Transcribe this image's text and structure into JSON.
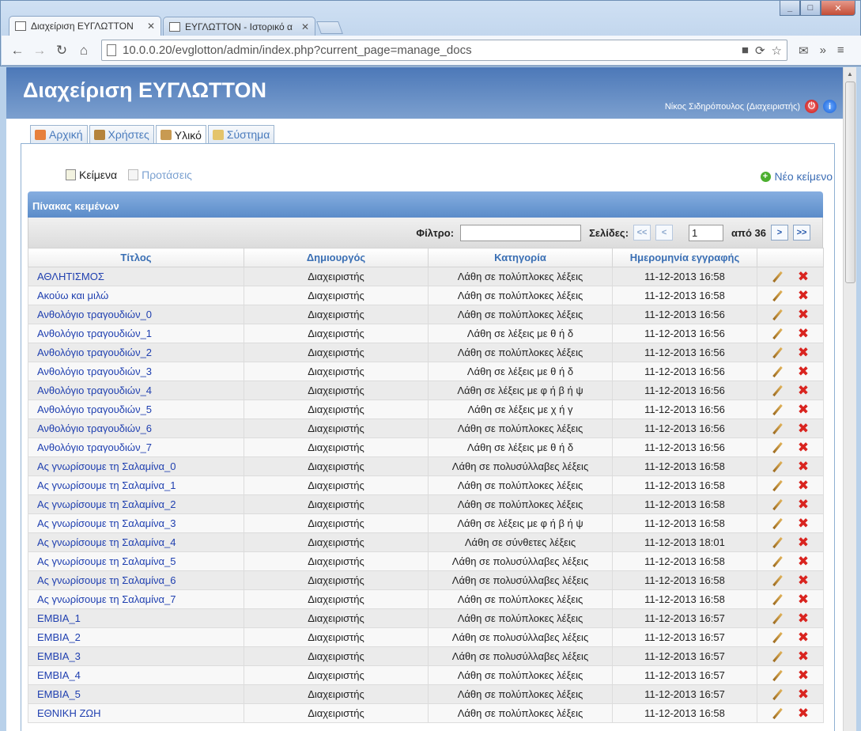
{
  "browser": {
    "tabs": [
      {
        "title": "Διαχείριση ΕΥΓΛΩΤΤΟΝ",
        "active": true
      },
      {
        "title": "ΕΥΓΛΩΤΤΟΝ - Ιστορικό α",
        "active": false
      }
    ],
    "url": "10.0.0.20/evglotton/admin/index.php?current_page=manage_docs"
  },
  "header": {
    "title": "Διαχείριση ΕΥΓΛΩΤΤΟΝ",
    "user": "Νίκος Σιδηρόπουλος (Διαχειριστής)"
  },
  "menu": [
    {
      "label": "Αρχική",
      "icon": "home-icon",
      "active": false
    },
    {
      "label": "Χρήστες",
      "icon": "users-icon",
      "active": false
    },
    {
      "label": "Υλικό",
      "icon": "books-icon",
      "active": true
    },
    {
      "label": "Σύστημα",
      "icon": "tools-icon",
      "active": false
    }
  ],
  "subnav": {
    "texts": "Κείμενα",
    "sentences": "Προτάσεις",
    "new_doc": "Νέο κείμενο"
  },
  "panel": {
    "title": "Πίνακας κειμένων",
    "filter_label": "Φίλτρο:",
    "pages_label": "Σελίδες:",
    "first_btn": "<<",
    "prev_btn": "<",
    "next_btn": ">",
    "last_btn": ">>",
    "current_page": "1",
    "of_label": "από 36"
  },
  "table": {
    "headers": [
      "Τίτλος",
      "Δημιουργός",
      "Κατηγορία",
      "Ημερομηνία εγγραφής",
      ""
    ],
    "rows": [
      [
        "ΑΘΛΗΤΙΣΜΟΣ",
        "Διαχειριστής",
        "Λάθη σε πολύπλοκες λέξεις",
        "11-12-2013 16:58"
      ],
      [
        "Ακούω και μιλώ",
        "Διαχειριστής",
        "Λάθη σε πολύπλοκες λέξεις",
        "11-12-2013 16:58"
      ],
      [
        "Ανθολόγιο τραγουδιών_0",
        "Διαχειριστής",
        "Λάθη σε πολύπλοκες λέξεις",
        "11-12-2013 16:56"
      ],
      [
        "Ανθολόγιο τραγουδιών_1",
        "Διαχειριστής",
        "Λάθη σε λέξεις με θ ή δ",
        "11-12-2013 16:56"
      ],
      [
        "Ανθολόγιο τραγουδιών_2",
        "Διαχειριστής",
        "Λάθη σε πολύπλοκες λέξεις",
        "11-12-2013 16:56"
      ],
      [
        "Ανθολόγιο τραγουδιών_3",
        "Διαχειριστής",
        "Λάθη σε λέξεις με θ ή δ",
        "11-12-2013 16:56"
      ],
      [
        "Ανθολόγιο τραγουδιών_4",
        "Διαχειριστής",
        "Λάθη σε λέξεις με φ ή β ή ψ",
        "11-12-2013 16:56"
      ],
      [
        "Ανθολόγιο τραγουδιών_5",
        "Διαχειριστής",
        "Λάθη σε λέξεις με χ ή γ",
        "11-12-2013 16:56"
      ],
      [
        "Ανθολόγιο τραγουδιών_6",
        "Διαχειριστής",
        "Λάθη σε πολύπλοκες λέξεις",
        "11-12-2013 16:56"
      ],
      [
        "Ανθολόγιο τραγουδιών_7",
        "Διαχειριστής",
        "Λάθη σε λέξεις με θ ή δ",
        "11-12-2013 16:56"
      ],
      [
        "Ας γνωρίσουμε τη Σαλαμίνα_0",
        "Διαχειριστής",
        "Λάθη σε πολυσύλλαβες λέξεις",
        "11-12-2013 16:58"
      ],
      [
        "Ας γνωρίσουμε τη Σαλαμίνα_1",
        "Διαχειριστής",
        "Λάθη σε πολύπλοκες λέξεις",
        "11-12-2013 16:58"
      ],
      [
        "Ας γνωρίσουμε τη Σαλαμίνα_2",
        "Διαχειριστής",
        "Λάθη σε πολύπλοκες λέξεις",
        "11-12-2013 16:58"
      ],
      [
        "Ας γνωρίσουμε τη Σαλαμίνα_3",
        "Διαχειριστής",
        "Λάθη σε λέξεις με φ ή β ή ψ",
        "11-12-2013 16:58"
      ],
      [
        "Ας γνωρίσουμε τη Σαλαμίνα_4",
        "Διαχειριστής",
        "Λάθη σε σύνθετες λέξεις",
        "11-12-2013 18:01"
      ],
      [
        "Ας γνωρίσουμε τη Σαλαμίνα_5",
        "Διαχειριστής",
        "Λάθη σε πολυσύλλαβες λέξεις",
        "11-12-2013 16:58"
      ],
      [
        "Ας γνωρίσουμε τη Σαλαμίνα_6",
        "Διαχειριστής",
        "Λάθη σε πολυσύλλαβες λέξεις",
        "11-12-2013 16:58"
      ],
      [
        "Ας γνωρίσουμε τη Σαλαμίνα_7",
        "Διαχειριστής",
        "Λάθη σε πολύπλοκες λέξεις",
        "11-12-2013 16:58"
      ],
      [
        "ΕΜΒΙΑ_1",
        "Διαχειριστής",
        "Λάθη σε πολύπλοκες λέξεις",
        "11-12-2013 16:57"
      ],
      [
        "ΕΜΒΙΑ_2",
        "Διαχειριστής",
        "Λάθη σε πολυσύλλαβες λέξεις",
        "11-12-2013 16:57"
      ],
      [
        "ΕΜΒΙΑ_3",
        "Διαχειριστής",
        "Λάθη σε πολυσύλλαβες λέξεις",
        "11-12-2013 16:57"
      ],
      [
        "ΕΜΒΙΑ_4",
        "Διαχειριστής",
        "Λάθη σε πολύπλοκες λέξεις",
        "11-12-2013 16:57"
      ],
      [
        "ΕΜΒΙΑ_5",
        "Διαχειριστής",
        "Λάθη σε πολύπλοκες λέξεις",
        "11-12-2013 16:57"
      ],
      [
        "ΕΘΝΙΚΗ ΖΩΗ",
        "Διαχειριστής",
        "Λάθη σε πολύπλοκες λέξεις",
        "11-12-2013 16:58"
      ]
    ]
  },
  "colors": {
    "banner": "#5a86c2",
    "link": "#2040b0",
    "header_text": "#3a6fb4",
    "delete": "#d9241f"
  }
}
